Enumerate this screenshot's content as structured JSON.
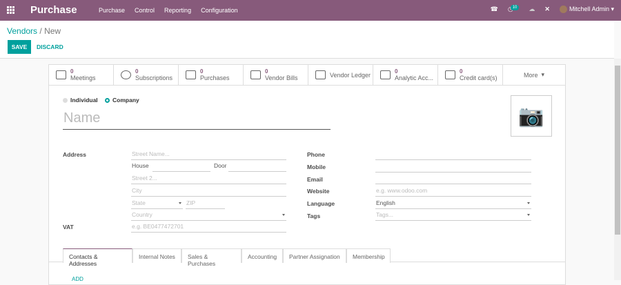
{
  "navbar": {
    "brand": "Purchase",
    "menu": [
      "Purchase",
      "Control",
      "Reporting",
      "Configuration"
    ],
    "activity_count": "10",
    "user": "Mitchell Admin"
  },
  "breadcrumb": {
    "parent": "Vendors",
    "current": "New"
  },
  "actions": {
    "save": "SAVE",
    "discard": "DISCARD"
  },
  "smart_buttons": [
    {
      "icon": "calendar-icon",
      "count": "0",
      "label": "Meetings"
    },
    {
      "icon": "refresh-icon",
      "count": "0",
      "label": "Subscriptions"
    },
    {
      "icon": "cart-icon",
      "count": "0",
      "label": "Purchases"
    },
    {
      "icon": "edit-icon",
      "count": "0",
      "label": "Vendor Bills"
    },
    {
      "icon": "edit-icon",
      "count": "",
      "label": "Vendor Ledger"
    },
    {
      "icon": "book-icon",
      "count": "0",
      "label": "Analytic Acc..."
    },
    {
      "icon": "credit-card-icon",
      "count": "0",
      "label": "Credit card(s)"
    }
  ],
  "more": "More",
  "form": {
    "type_options": [
      "Individual",
      "Company"
    ],
    "type_selected": "Company",
    "name_placeholder": "Name",
    "labels": {
      "address": "Address",
      "vat": "VAT",
      "phone": "Phone",
      "mobile": "Mobile",
      "email": "Email",
      "website": "Website",
      "language": "Language",
      "tags": "Tags"
    },
    "placeholders": {
      "street": "Street Name...",
      "house": "House",
      "door": "Door",
      "street2": "Street 2...",
      "city": "City",
      "state": "State",
      "zip": "ZIP",
      "country": "Country",
      "vat": "e.g. BE0477472701",
      "website": "e.g. www.odoo.com",
      "tags": "Tags..."
    },
    "language_value": "English"
  },
  "tabs": [
    "Contacts & Addresses",
    "Internal Notes",
    "Sales & Purchases",
    "Accounting",
    "Partner Assignation",
    "Membership"
  ],
  "add_link": "ADD"
}
